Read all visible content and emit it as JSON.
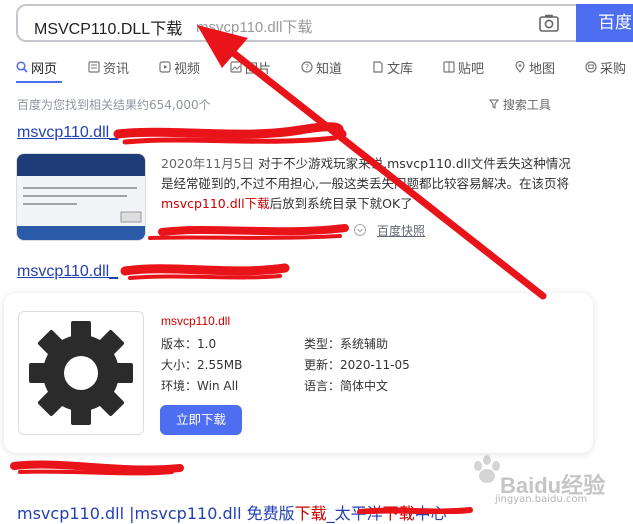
{
  "search": {
    "query": "MSVCP110.DLL下载",
    "suggestion": "msvcp110.dll下载",
    "button_label": "百度"
  },
  "tabs": [
    {
      "label": "网页",
      "icon": "search-icon",
      "active": true
    },
    {
      "label": "资讯",
      "icon": "news-icon"
    },
    {
      "label": "视频",
      "icon": "video-icon"
    },
    {
      "label": "图片",
      "icon": "image-icon"
    },
    {
      "label": "知道",
      "icon": "question-icon"
    },
    {
      "label": "文库",
      "icon": "document-icon"
    },
    {
      "label": "贴吧",
      "icon": "forum-icon"
    },
    {
      "label": "地图",
      "icon": "map-pin-icon"
    },
    {
      "label": "采购",
      "icon": "cart-icon"
    }
  ],
  "result_count": "百度为您找到相关结果约654,000个",
  "search_tools": "搜索工具",
  "result1": {
    "title": "msvcp110.dll_",
    "date": "2020年11月5日",
    "snippet_a": "对于不少游戏玩家来说,msvcp110.dll文件丢失这种情况是经常碰到的,不过不用担心,一般这类丢失问题都比较容易解决。在该页将",
    "snippet_hl": "msvcp110.dll下载",
    "snippet_b": "后放到系统目录下就OK了",
    "snapshot": "百度快照"
  },
  "result2": {
    "title": "msvcp110.dll_"
  },
  "software": {
    "name": "msvcp110.dll",
    "version_label": "版本：",
    "version": "1.0",
    "type_label": "类型：",
    "type": "系统辅助",
    "size_label": "大小：",
    "size": "2.55MB",
    "updated_label": "更新：",
    "updated": "2020-11-05",
    "env_label": "环境：",
    "env": "Win All",
    "lang_label": "语言：",
    "lang": "简体中文",
    "download_label": "立即下载"
  },
  "result3": {
    "title_a": "msvcp110.dll |msvcp110.dll 免费版",
    "title_hl1": "下载",
    "title_b": "_太平洋",
    "title_hl2": "下载",
    "title_c": "中心"
  },
  "watermark": {
    "text": "Baidu经验",
    "url": "jingyan.baidu.com"
  },
  "colors": {
    "accent": "#4e6ef2",
    "link": "#2440b3",
    "highlight": "#cc0000",
    "annotation": "#e8141a"
  }
}
